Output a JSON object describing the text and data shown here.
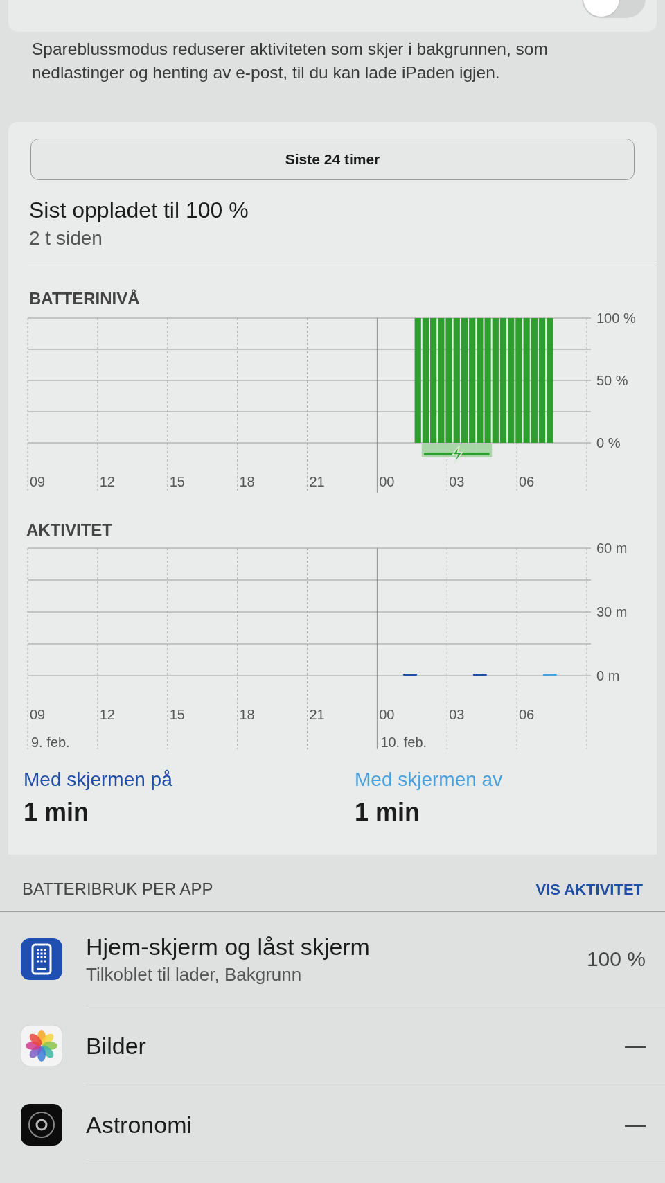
{
  "top_card": {
    "toggle": {
      "on": false
    }
  },
  "description": "Spareblussmodus reduserer aktiviteten som skjer i bakgrunnen, som nedlastinger og henting av e-post, til du kan lade iPaden igjen.",
  "range_button": {
    "label": "Siste 24 timer"
  },
  "last_charged": {
    "title": "Sist oppladet til 100 %",
    "subtitle": "2 t siden"
  },
  "battery_level": {
    "charging": [
      false,
      false,
      false,
      false,
      false,
      false,
      false,
      false,
      false,
      false,
      false,
      false,
      false,
      false,
      false,
      false,
      false,
      false,
      false,
      false,
      false,
      false,
      false,
      false,
      false,
      false,
      false,
      false,
      false,
      false,
      false,
      false,
      false,
      false,
      false,
      false,
      false,
      false,
      false,
      false,
      false,
      false,
      false,
      false,
      false,
      false,
      false,
      false,
      false,
      false,
      true,
      true,
      true,
      true,
      true,
      true,
      true,
      true,
      true,
      false,
      false,
      false,
      false,
      false,
      false,
      false,
      false,
      false,
      false,
      false,
      false,
      false
    ],
    "chart_data": {
      "type": "bar",
      "title": "BATTERINIVÅ",
      "categories": [
        "09",
        null,
        null,
        null,
        null,
        null,
        null,
        null,
        null,
        "12",
        null,
        null,
        null,
        null,
        null,
        null,
        null,
        null,
        "15",
        null,
        null,
        null,
        null,
        null,
        null,
        null,
        null,
        "18",
        null,
        null,
        null,
        null,
        null,
        null,
        null,
        null,
        "21",
        null,
        null,
        null,
        null,
        null,
        null,
        null,
        null,
        "00",
        null,
        null,
        null,
        null,
        null,
        null,
        null,
        null,
        "03",
        null,
        null,
        null,
        null,
        null,
        null,
        null,
        null,
        "06",
        null,
        null,
        null,
        null,
        null,
        null,
        null,
        null
      ],
      "series": [
        {
          "color": "#2e9e2e",
          "values": [
            null,
            null,
            null,
            null,
            null,
            null,
            null,
            null,
            null,
            null,
            null,
            null,
            null,
            null,
            null,
            null,
            null,
            null,
            null,
            null,
            null,
            null,
            null,
            null,
            null,
            null,
            null,
            null,
            null,
            null,
            null,
            null,
            null,
            null,
            null,
            null,
            null,
            null,
            null,
            null,
            null,
            null,
            null,
            null,
            null,
            null,
            null,
            null,
            null,
            100,
            100,
            100,
            100,
            100,
            100,
            100,
            100,
            100,
            100,
            100,
            100,
            100,
            100,
            100,
            100,
            100,
            100,
            null,
            null,
            null,
            null,
            null
          ]
        }
      ],
      "ylim": [
        0,
        100
      ],
      "yticks": [
        {
          "value": 0,
          "label": "0 %"
        },
        {
          "value": 50,
          "label": "50 %"
        },
        {
          "value": 100,
          "label": "100 %"
        }
      ]
    }
  },
  "activity": {
    "chart_data": {
      "type": "bar",
      "stacked": true,
      "title": "AKTIVITET",
      "categories": [
        "09",
        null,
        null,
        "12",
        null,
        null,
        "15",
        null,
        null,
        "18",
        null,
        null,
        "21",
        null,
        null,
        "00",
        null,
        null,
        "03",
        null,
        null,
        "06",
        null,
        null
      ],
      "series": [
        {
          "name": "Med skjermen på",
          "color": "#1f4ea3",
          "values": [
            null,
            null,
            null,
            null,
            null,
            null,
            null,
            null,
            null,
            null,
            null,
            null,
            null,
            null,
            null,
            null,
            1,
            null,
            null,
            1,
            null,
            null,
            null,
            null
          ]
        },
        {
          "name": "Med skjermen av",
          "color": "#4aa0dc",
          "values": [
            null,
            null,
            null,
            null,
            null,
            null,
            null,
            null,
            null,
            null,
            null,
            null,
            null,
            null,
            null,
            null,
            null,
            null,
            null,
            null,
            null,
            null,
            1,
            null
          ]
        }
      ],
      "ylim": [
        0,
        60
      ],
      "yticks": [
        {
          "value": 0,
          "label": "0 m"
        },
        {
          "value": 30,
          "label": "30 m"
        },
        {
          "value": 60,
          "label": "60 m"
        }
      ]
    },
    "dates": [
      {
        "label": "9. feb."
      },
      {
        "label": "10. feb."
      }
    ],
    "totals": [
      {
        "value": "1 min"
      },
      {
        "value": "1 min"
      }
    ]
  },
  "app_usage": {
    "heading": "BATTERIBRUK PER APP",
    "action": "VIS AKTIVITET",
    "apps": [
      {
        "kind": "home-screen",
        "name": "Hjem-skjerm og låst skjerm",
        "detail": "Tilkoblet til lader, Bakgrunn",
        "usage": "100 %"
      },
      {
        "kind": "photos",
        "name": "Bilder",
        "usage": "—"
      },
      {
        "kind": "astronomy",
        "name": "Astronomi",
        "usage": "—"
      }
    ]
  }
}
